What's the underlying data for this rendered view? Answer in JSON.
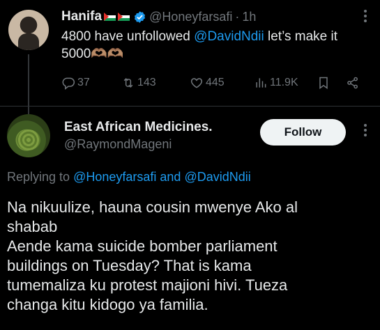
{
  "parent_tweet": {
    "author_name": "Hanifa",
    "author_handle": "@Honeyfarsafi",
    "dot": "·",
    "time": "1h",
    "text_before": "4800 have unfollowed ",
    "mention": "@DavidNdii",
    "text_after": " let’s make it",
    "text_line2": "5000🫶🏽🫶🏽",
    "stats": {
      "replies": "37",
      "retweets": "143",
      "likes": "445",
      "views": "11.9K"
    }
  },
  "reply_tweet": {
    "author_name": "East African Medicines.",
    "author_handle": "@RaymondMageni",
    "follow_label": "Follow",
    "replying_prefix": "Replying to ",
    "replying_user1": "@Honeyfarsafi",
    "replying_and": " and ",
    "replying_user2": "@DavidNdii",
    "body_lines": [
      "Na nikuulize, hauna cousin mwenye Ako al",
      "shabab",
      "Aende kama suicide bomber parliament",
      "buildings on Tuesday? That is kama",
      "tumemaliza ku protest majioni hivi. Tueza",
      "changa kitu kidogo ya familia."
    ]
  },
  "colors": {
    "background": "#000000",
    "text": "#e7e9ea",
    "muted": "#71767b",
    "link": "#1d9bf0",
    "follow_bg": "#eff3f4"
  }
}
